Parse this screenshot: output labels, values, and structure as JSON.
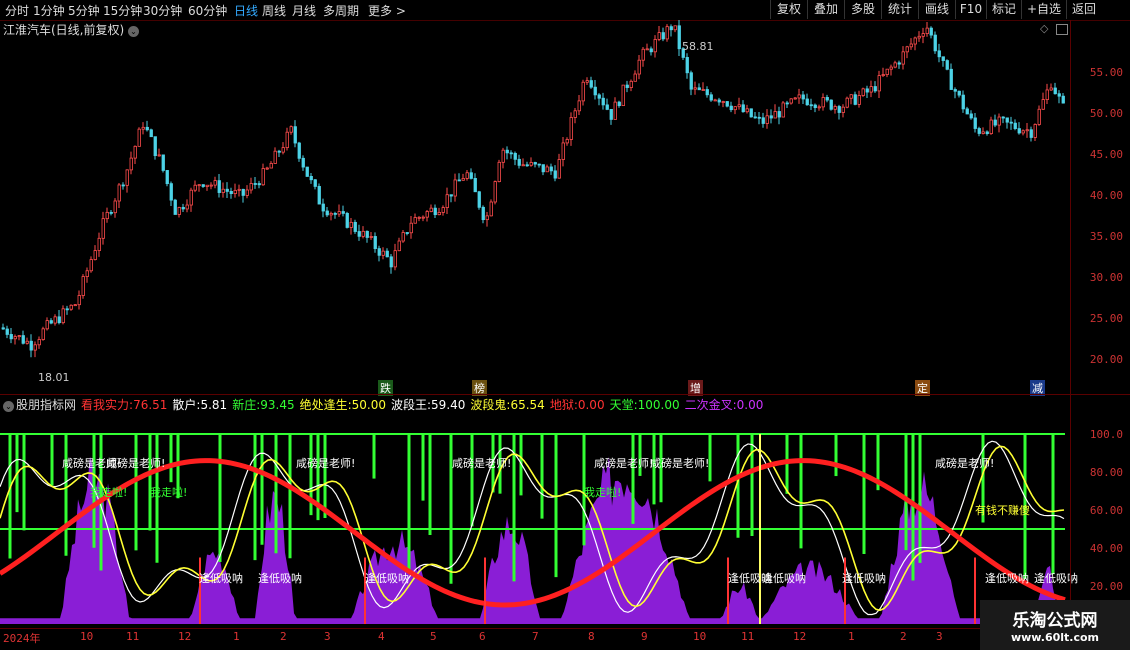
{
  "toolbar": {
    "tabs": [
      "分时",
      "1分钟",
      "5分钟",
      "15分钟",
      "30分钟",
      "60分钟",
      "日线",
      "周线",
      "月线",
      "多周期",
      "更多 >"
    ],
    "active_tab": "日线",
    "right_buttons": [
      "复权",
      "叠加",
      "多股",
      "统计",
      "画线",
      "F10",
      "标记",
      "+自选",
      "返回"
    ]
  },
  "main_chart": {
    "title": "江淮汽车(日线,前复权)",
    "y_ticks": [
      "55.00",
      "50.00",
      "45.00",
      "40.00",
      "35.00",
      "30.00",
      "25.00",
      "20.00"
    ],
    "high_label": "58.81",
    "low_label": "18.01",
    "events": [
      {
        "label": "跌",
        "color": "#4caf50"
      },
      {
        "label": "榜",
        "color": "#c9a227"
      },
      {
        "label": "增",
        "color": "#ff6666"
      },
      {
        "label": "定",
        "color": "#e08a2e"
      },
      {
        "label": "减",
        "color": "#4a7fff"
      }
    ]
  },
  "indicator": {
    "name": "股朋指标网",
    "values": [
      {
        "label": "看我实力:",
        "value": "76.51",
        "color": "#ff3333"
      },
      {
        "label": "散户:",
        "value": "5.81",
        "color": "#ffffff"
      },
      {
        "label": "新庄:",
        "value": "93.45",
        "color": "#33ff33"
      },
      {
        "label": "绝处逢生:",
        "value": "50.00",
        "color": "#ffff33"
      },
      {
        "label": "波段王:",
        "value": "59.40",
        "color": "#ffffff"
      },
      {
        "label": "波段鬼:",
        "value": "65.54",
        "color": "#ffff33"
      },
      {
        "label": "地狱:",
        "value": "0.00",
        "color": "#ff3333"
      },
      {
        "label": "天堂:",
        "value": "100.00",
        "color": "#33ff33"
      },
      {
        "label": "二次金叉:",
        "value": "0.00",
        "color": "#cc33ff"
      }
    ],
    "y_ticks": [
      "100.0",
      "80.00",
      "60.00",
      "40.00",
      "20.00"
    ],
    "annotations": {
      "teacher": "咸磅是老师!",
      "run": "我走啦!",
      "buy_low": "逢低吸呐",
      "money": "有钱不赚傻"
    }
  },
  "x_axis": {
    "labels": [
      "2024年",
      "10",
      "11",
      "12",
      "1",
      "2",
      "3",
      "4",
      "5",
      "6",
      "7",
      "8",
      "9",
      "10",
      "11",
      "12",
      "1",
      "2",
      "3"
    ]
  },
  "watermark": {
    "name": "乐淘公式网",
    "url": "www.60lt.com"
  }
}
